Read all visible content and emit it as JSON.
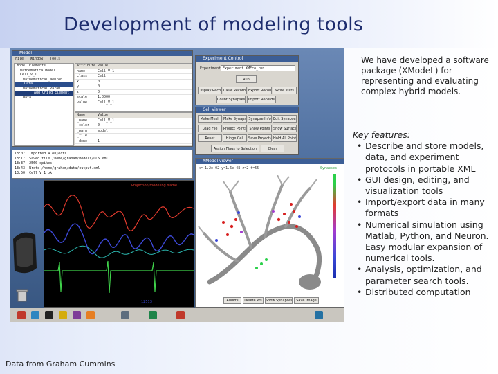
{
  "slide": {
    "title": "Development of modeling tools",
    "credit": "Data from Graham Cummins",
    "description": "We have developed a software package (XModeL) for representing and evaluating complex hybrid models.",
    "features_heading": "Key features:",
    "features": [
      "Describe and store models, data, and experiment protocols in portable XML",
      "GUI design, editing, and visualization tools",
      "Import/export data in many formats",
      "Numerical simulation using Matlab, Python, and Neuron. Easy modular expansion of numerical tools.",
      "Analysis, optimization, and parameter search tools.",
      "Distributed computation"
    ]
  },
  "screenshot": {
    "model_window": {
      "title": "Model",
      "menu": [
        "File",
        "Window",
        "Tools"
      ],
      "tree": [
        "Model Elements",
        "mathematicalModel",
        "Cell_V_1",
        "mathematical_Neuron",
        "Data",
        "mathematical_Param",
        "Add Child Element",
        "Data"
      ],
      "attr_headers": [
        "Attribute",
        "Value"
      ],
      "attr_rows": [
        [
          "name",
          "Cell_V_1"
        ],
        [
          "class",
          "Cell"
        ],
        [
          "x",
          "0"
        ],
        [
          "y",
          "0"
        ],
        [
          "z",
          "0"
        ],
        [
          "scale",
          "1.0000"
        ],
        [
          "value",
          "Cell_V_1"
        ]
      ],
      "lower_headers": [
        "Name",
        "Value"
      ],
      "lower_rows": [
        [
          "_name",
          "Cell_V_1"
        ],
        [
          "_color",
          "0"
        ],
        [
          "_parm",
          "model"
        ],
        [
          "_file",
          "..."
        ],
        [
          "_done",
          "1"
        ]
      ],
      "console_lines": [
        "13:07: Imported 4 objects",
        "13:17: Saved file /home/graham/models/GCS.xml",
        "13:37: 2560 spikes",
        "13:43: Wrote /home/graham/data/output.xml",
        "13:50: Cell_V_1 ok"
      ]
    },
    "control_window": {
      "title": "Experiment Control",
      "label": "Experiment",
      "select_value": "Experiment XMEco_run",
      "run_label": "Run",
      "buttons": [
        "Display Records",
        "Clear Records",
        "Export Records",
        "Write stats"
      ],
      "buttons2": [
        "Count Synapses",
        "Import Records"
      ]
    },
    "cell_window": {
      "title": "Cell Viewer",
      "buttons": [
        "Make Mesh",
        "Make Synapses",
        "Synapse Info",
        "Edit Synapses"
      ],
      "buttons2": [
        "Load File",
        "Project Points",
        "Show Points",
        "Show Surface"
      ],
      "buttons3": [
        "Reset",
        "Hinge Cell",
        "Save Projection",
        "Hold All Points"
      ],
      "buttons4": [
        "Assign Flags to Selection",
        "Clear"
      ]
    },
    "view_window": {
      "title": "XModel viewer",
      "readout": "x=-1.2e+02 y=1.6e-48 z=2 t=55",
      "legend_label": "Synapses",
      "buttons": [
        "AddPts",
        "Delete Pts",
        "Show Synapses",
        "Save Image"
      ]
    },
    "plot_window": {
      "header_text": "Projection/modeling frame",
      "footer_text": "12513"
    },
    "taskbar_icons": [
      "home",
      "browser",
      "terminal",
      "mail",
      "editor",
      "folder",
      "monitor",
      "settings",
      "viewer",
      "network"
    ],
    "colors": {
      "desktop": "#4d6e9e",
      "title_bar": "#3c5e96",
      "trace_red": "#e33b2e",
      "trace_blue": "#3d49d8",
      "trace_green": "#3fd24a",
      "trace_teal": "#2bb8b0"
    }
  }
}
